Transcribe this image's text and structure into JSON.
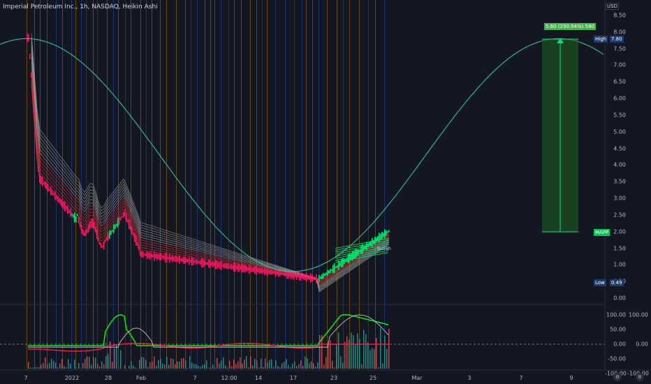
{
  "header": {
    "title": "Imperial Petroleum Inc., 1h, NASDAQ, Heikin Ashi"
  },
  "price_axis": {
    "currency": "USD",
    "ticks": [
      "8.50",
      "8.00",
      "7.50",
      "7.00",
      "6.50",
      "6.00",
      "5.50",
      "5.00",
      "4.50",
      "4.00",
      "3.50",
      "3.00",
      "2.50",
      "2.00",
      "1.50",
      "1.00",
      "0.50",
      "0.00"
    ]
  },
  "osc_axis": {
    "ticks": [
      "100.00",
      "50.00",
      "0.00",
      "-50.00",
      "-100.00"
    ]
  },
  "osc_right_axis": {
    "ticks": [
      "100.00",
      "0.00",
      "-100.00"
    ]
  },
  "time_axis": {
    "ticks": [
      "7",
      "2022",
      "28",
      "Feb",
      "7",
      "12:00",
      "14",
      "17",
      "23",
      "25",
      "Mar",
      "3",
      "7",
      "9"
    ]
  },
  "markers": {
    "high_label": "High",
    "high_value": "7.80",
    "low_label": "Low",
    "low_value": "0.49",
    "mapp_label": "MAPP",
    "mapp_value": "2.00"
  },
  "measure": {
    "label": "5.80 (290.94%) 580"
  },
  "watermark": {
    "text": "Bullish"
  },
  "corner": {
    "settings": "⚙",
    "logo": "B"
  },
  "colors": {
    "background": "#131722",
    "price_line": "#2ed1a0",
    "measure_fill": "#1b5e20",
    "measure_line": "#00e676",
    "ribbon_red": "#e53935",
    "ribbon_green": "#00e676",
    "candle_pink": "#e91e63",
    "osc_green": "#00ff00",
    "osc_red": "#ff1744",
    "osc_white": "#d1d4dc"
  },
  "chart_data": {
    "type": "line",
    "title": "Imperial Petroleum Inc., 1h, NASDAQ, Heikin Ashi",
    "ylim": [
      0,
      8.5
    ],
    "series": [
      {
        "name": "",
        "x": [
          "7",
          "2022",
          "28",
          "Feb",
          "7",
          "12:00",
          "14",
          "17",
          "23",
          "25"
        ],
        "values": [
          7.8,
          3.2,
          2.4,
          1.6,
          1.1,
          0.95,
          0.9,
          0.8,
          0.6,
          2.0
        ]
      }
    ]
  }
}
